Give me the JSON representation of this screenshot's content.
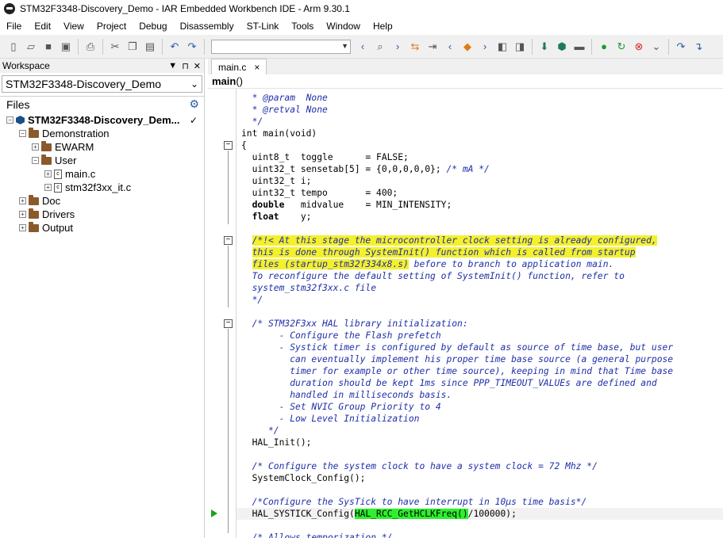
{
  "window": {
    "title": "STM32F3348-Discovery_Demo - IAR Embedded Workbench IDE - Arm 9.30.1"
  },
  "menu": [
    "File",
    "Edit",
    "View",
    "Project",
    "Debug",
    "Disassembly",
    "ST-Link",
    "Tools",
    "Window",
    "Help"
  ],
  "workspace": {
    "header": "Workspace",
    "header_buttons": [
      "▼",
      "⊓",
      "✕"
    ],
    "selected": "STM32F3348-Discovery_Demo",
    "files_label": "Files",
    "check": "✓",
    "tree": [
      {
        "label": "STM32F3348-Discovery_Dem...",
        "type": "project",
        "level": 0,
        "expander": "−"
      },
      {
        "label": "Demonstration",
        "type": "folder",
        "level": 1,
        "expander": "−"
      },
      {
        "label": "EWARM",
        "type": "folder",
        "level": 2,
        "expander": "+"
      },
      {
        "label": "User",
        "type": "folder",
        "level": 2,
        "expander": "−"
      },
      {
        "label": "main.c",
        "type": "file",
        "level": 3,
        "expander": "+"
      },
      {
        "label": "stm32f3xx_it.c",
        "type": "file",
        "level": 3,
        "expander": "+"
      },
      {
        "label": "Doc",
        "type": "folder",
        "level": 1,
        "expander": "+"
      },
      {
        "label": "Drivers",
        "type": "folder",
        "level": 1,
        "expander": "+"
      },
      {
        "label": "Output",
        "type": "folder",
        "level": 1,
        "expander": "+"
      }
    ]
  },
  "editor": {
    "tab_label": "main.c",
    "tab_close": "×",
    "function_name": "main",
    "function_caret": "()",
    "lines": [
      [
        {
          "t": "  * @param  None",
          "c": "cm"
        }
      ],
      [
        {
          "t": "  * @retval None",
          "c": "cm"
        }
      ],
      [
        {
          "t": "  */",
          "c": "cm"
        }
      ],
      [
        {
          "t": "int main(void)",
          "c": ""
        }
      ],
      [
        {
          "t": "{",
          "c": ""
        }
      ],
      [
        {
          "t": "  uint8_t  toggle      = FALSE;",
          "c": ""
        }
      ],
      [
        {
          "t": "  uint32_t sensetab[5] = {0,0,0,0,0}; ",
          "c": ""
        },
        {
          "t": "/* mA */",
          "c": "cm"
        }
      ],
      [
        {
          "t": "  uint32_t i;",
          "c": ""
        }
      ],
      [
        {
          "t": "  uint32_t tempo       = 400;",
          "c": ""
        }
      ],
      [
        {
          "t": "  double",
          "c": "kw"
        },
        {
          "t": "   midvalue    = MIN_INTENSITY;",
          "c": ""
        }
      ],
      [
        {
          "t": "  float",
          "c": "kw"
        },
        {
          "t": "    y;",
          "c": ""
        }
      ],
      [
        {
          "t": "",
          "c": ""
        }
      ],
      [
        {
          "t": "  ",
          "c": ""
        },
        {
          "t": "/*!< At this stage the microcontroller clock setting is already configured,",
          "c": "cm hl-y"
        }
      ],
      [
        {
          "t": "  ",
          "c": ""
        },
        {
          "t": "this is done through SystemInit() function which is called from startup",
          "c": "cm hl-y"
        }
      ],
      [
        {
          "t": "  ",
          "c": ""
        },
        {
          "t": "files (startup_stm32f334x8.s)",
          "c": "cm hl-y"
        },
        {
          "t": " before to branch to application main.",
          "c": "cm"
        }
      ],
      [
        {
          "t": "  To reconfigure the default setting of SystemInit() function, refer to",
          "c": "cm"
        }
      ],
      [
        {
          "t": "  system_stm32f3xx.c file",
          "c": "cm"
        }
      ],
      [
        {
          "t": "  */",
          "c": "cm"
        }
      ],
      [
        {
          "t": "",
          "c": ""
        }
      ],
      [
        {
          "t": "  /* STM32F3xx HAL library initialization:",
          "c": "cm"
        }
      ],
      [
        {
          "t": "       - Configure the Flash prefetch",
          "c": "cm"
        }
      ],
      [
        {
          "t": "       - Systick timer is configured by default as source of time base, but user",
          "c": "cm"
        }
      ],
      [
        {
          "t": "         can eventually implement his proper time base source (a general purpose",
          "c": "cm"
        }
      ],
      [
        {
          "t": "         timer for example or other time source), keeping in mind that Time base",
          "c": "cm"
        }
      ],
      [
        {
          "t": "         duration should be kept 1ms since PPP_TIMEOUT_VALUEs are defined and",
          "c": "cm"
        }
      ],
      [
        {
          "t": "         handled in milliseconds basis.",
          "c": "cm"
        }
      ],
      [
        {
          "t": "       - Set NVIC Group Priority to 4",
          "c": "cm"
        }
      ],
      [
        {
          "t": "       - Low Level Initialization",
          "c": "cm"
        }
      ],
      [
        {
          "t": "     */",
          "c": "cm"
        }
      ],
      [
        {
          "t": "  HAL_Init();",
          "c": ""
        }
      ],
      [
        {
          "t": "",
          "c": ""
        }
      ],
      [
        {
          "t": "  /* Configure the system clock to have a system clock = 72 Mhz */",
          "c": "cm"
        }
      ],
      [
        {
          "t": "  SystemClock_Config();",
          "c": ""
        }
      ],
      [
        {
          "t": "",
          "c": ""
        }
      ],
      [
        {
          "t": "  /*Configure the SysTick to have interrupt in 10µs time basis*/",
          "c": "cm"
        }
      ],
      [
        {
          "t": "  HAL_SYSTICK_Config(",
          "c": ""
        },
        {
          "t": "HAL_RCC_GetHCLKFreq()",
          "c": "hl-g"
        },
        {
          "t": "/100000);",
          "c": ""
        }
      ],
      [
        {
          "t": "",
          "c": ""
        }
      ],
      [
        {
          "t": "  /* Allows temporization */",
          "c": "cm"
        }
      ]
    ]
  }
}
